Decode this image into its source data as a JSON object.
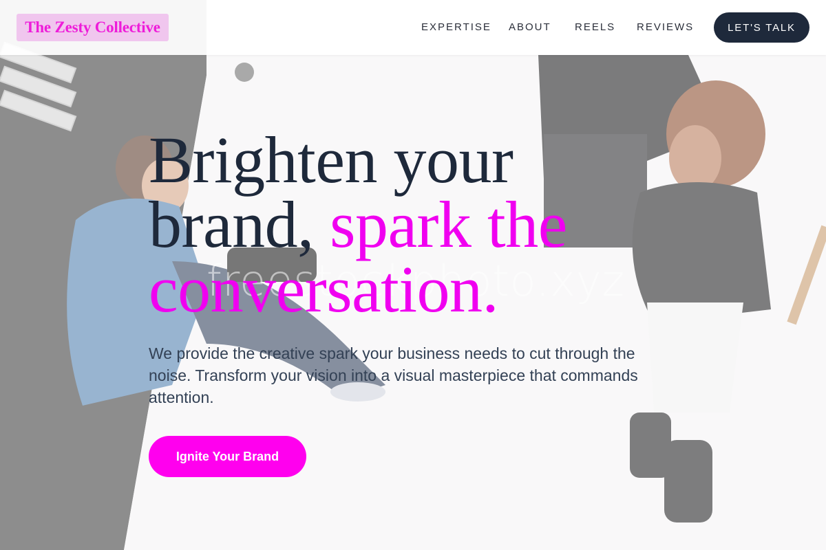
{
  "brand": {
    "name": "The Zesty Collective"
  },
  "nav": {
    "items": [
      {
        "label": "EXPERTISE"
      },
      {
        "label": "ABOUT"
      },
      {
        "label": "REELS"
      },
      {
        "label": "REVIEWS"
      }
    ],
    "cta_label": "LET'S TALK"
  },
  "hero": {
    "title_part1": "Brighten your brand, ",
    "title_accent": "spark the conversation.",
    "description": "We provide the creative spark your business needs to cut through the noise. Transform your vision into a visual masterpiece that commands attention.",
    "cta_label": "Ignite Your Brand",
    "watermark": "freestockphoto.xyz"
  },
  "colors": {
    "accent": "#f000f0",
    "button_accent": "#ff00ee",
    "dark": "#1e293b",
    "logo_bg": "#f0c6ee",
    "logo_text": "#ee1cd9"
  }
}
